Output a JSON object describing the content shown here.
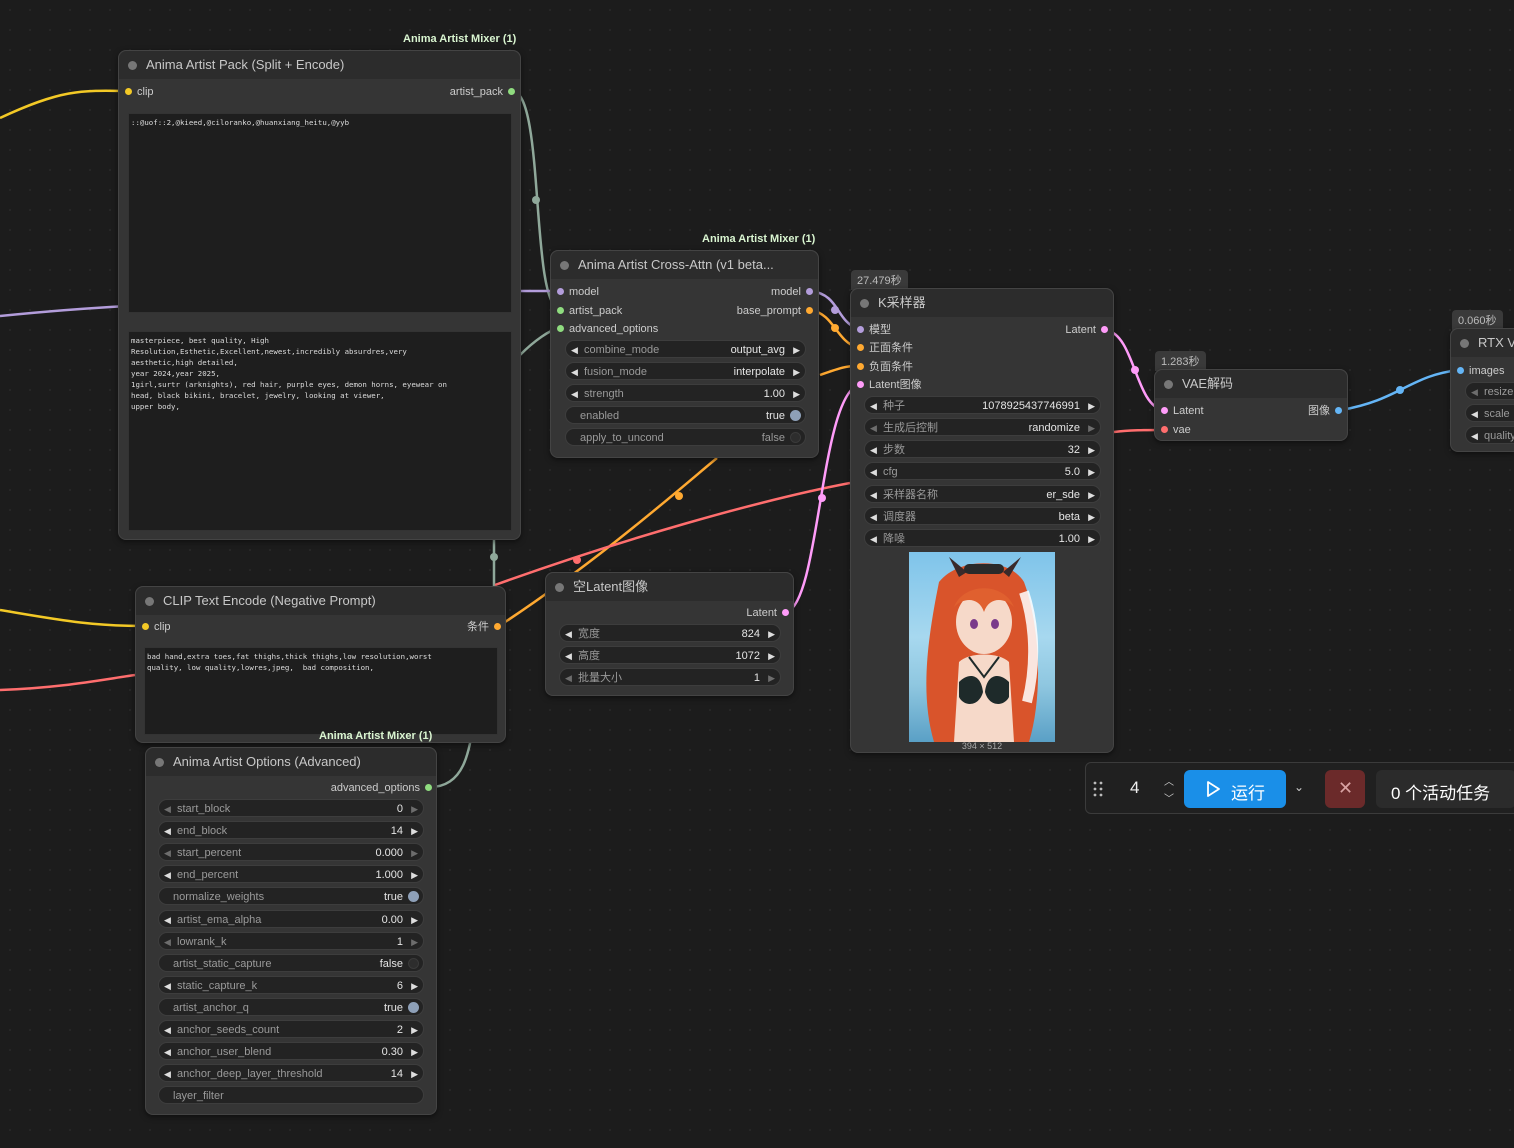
{
  "nodes": {
    "artist_pack": {
      "badge": "Anima Artist Mixer (1)",
      "title": "Anima Artist Pack (Split + Encode)",
      "input_clip": "clip",
      "output_artist_pack": "artist_pack",
      "artist_text": "::@uof::2,@kieed,@ciloranko,@huanxiang_heitu,@yyb",
      "prompt_text": "masterpiece, best quality, High\nResolution,Esthetic,Excellent,newest,incredibly absurdres,very\naesthetic,high detailed,\nyear 2024,year 2025,\n1girl,surtr (arknights), red hair, purple eyes, demon horns, eyewear on\nhead, black bikini, bracelet, jewelry, looking at viewer,\nupper body,"
    },
    "cross_attn": {
      "badge": "Anima Artist Mixer (1)",
      "title": "Anima Artist Cross-Attn (v1 beta...",
      "in_model": "model",
      "in_artist_pack": "artist_pack",
      "in_advanced_options": "advanced_options",
      "out_model": "model",
      "out_base_prompt": "base_prompt",
      "widgets": [
        {
          "label": "combine_mode",
          "value": "output_avg"
        },
        {
          "label": "fusion_mode",
          "value": "interpolate"
        },
        {
          "label": "strength",
          "value": "1.00"
        },
        {
          "label": "enabled",
          "value": "true"
        },
        {
          "label": "apply_to_uncond",
          "value": "false"
        }
      ]
    },
    "ksampler": {
      "time": "27.479秒",
      "title": "K采样器",
      "in_model": "模型",
      "in_positive": "正面条件",
      "in_negative": "负面条件",
      "in_latent": "Latent图像",
      "out_latent": "Latent",
      "widgets": [
        {
          "label": "种子",
          "value": "1078925437746991"
        },
        {
          "label": "生成后控制",
          "value": "randomize"
        },
        {
          "label": "步数",
          "value": "32"
        },
        {
          "label": "cfg",
          "value": "5.0"
        },
        {
          "label": "采样器名称",
          "value": "er_sde"
        },
        {
          "label": "调度器",
          "value": "beta"
        },
        {
          "label": "降噪",
          "value": "1.00"
        }
      ],
      "preview_size": "394 × 512"
    },
    "vae_decode": {
      "time": "1.283秒",
      "title": "VAE解码",
      "in_latent": "Latent",
      "in_vae": "vae",
      "out_image": "图像"
    },
    "rtx": {
      "time": "0.060秒",
      "title": "RTX V",
      "in_images": "images",
      "widgets": [
        "resize",
        "scale",
        "quality"
      ]
    },
    "clip_neg": {
      "title": "CLIP Text Encode (Negative Prompt)",
      "in_clip": "clip",
      "out_cond": "条件",
      "text": "bad hand,extra toes,fat thighs,thick thighs,low resolution,worst\nquality, low quality,lowres,jpeg,  bad composition,"
    },
    "empty_latent": {
      "title": "空Latent图像",
      "out_latent": "Latent",
      "widgets": [
        {
          "label": "宽度",
          "value": "824"
        },
        {
          "label": "高度",
          "value": "1072"
        },
        {
          "label": "批量大小",
          "value": "1"
        }
      ]
    },
    "options": {
      "badge": "Anima Artist Mixer (1)",
      "title": "Anima Artist Options (Advanced)",
      "out_advanced_options": "advanced_options",
      "widgets": [
        {
          "label": "start_block",
          "value": "0"
        },
        {
          "label": "end_block",
          "value": "14"
        },
        {
          "label": "start_percent",
          "value": "0.000"
        },
        {
          "label": "end_percent",
          "value": "1.000"
        },
        {
          "label": "normalize_weights",
          "value": "true"
        },
        {
          "label": "artist_ema_alpha",
          "value": "0.00"
        },
        {
          "label": "lowrank_k",
          "value": "1"
        },
        {
          "label": "artist_static_capture",
          "value": "false"
        },
        {
          "label": "static_capture_k",
          "value": "6"
        },
        {
          "label": "artist_anchor_q",
          "value": "true"
        },
        {
          "label": "anchor_seeds_count",
          "value": "2"
        },
        {
          "label": "anchor_user_blend",
          "value": "0.30"
        },
        {
          "label": "anchor_deep_layer_threshold",
          "value": "14"
        },
        {
          "label": "layer_filter",
          "value": ""
        }
      ]
    }
  },
  "toolbar": {
    "batch_count": "4",
    "run_label": "运行",
    "active_tasks": "0 个活动任务"
  },
  "colors": {
    "clip": "#f3c926",
    "model": "#b39ddb",
    "conditioning": "#ffa931",
    "latent": "#ff9cf9",
    "vae": "#ff6e6e",
    "image": "#64b5f6",
    "options": "#8fa89a",
    "run_button": "#1a8fe8",
    "cancel_button": "#6b2a2a"
  }
}
